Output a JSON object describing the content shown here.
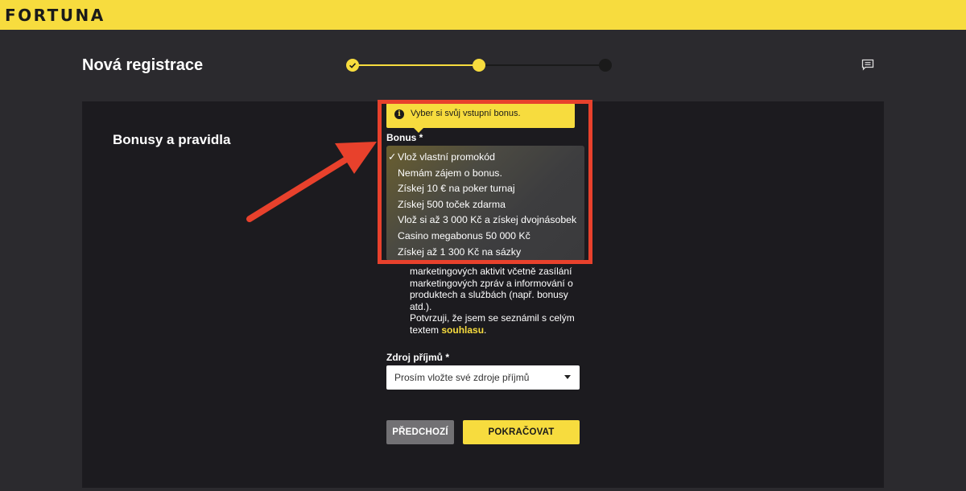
{
  "header": {
    "logo": "FORTUNA"
  },
  "page": {
    "title": "Nová registrace"
  },
  "stepper": {
    "steps_total": 3,
    "current_step": 2,
    "active_color": "#f7dc3e",
    "inactive_color": "#1a1a1a"
  },
  "section": {
    "title": "Bonusy a pravidla"
  },
  "bonus": {
    "tooltip": "Vyber si svůj vstupní bonus.",
    "label": "Bonus *",
    "selected_mark": "✓",
    "options": [
      "Vlož vlastní promokód",
      "Nemám zájem o bonus.",
      "Získej 10 € na poker turnaj",
      "Získej 500 toček zdarma",
      "Vlož si až 3 000 Kč a získej dvojnásobek",
      "Casino megabonus 50 000 Kč",
      "Získej až 1 300 Kč na sázky"
    ],
    "selected_index": 0
  },
  "consent": {
    "lines": [
      "marketingových aktivit včetně zasílání",
      "marketingových zpráv a informování o",
      "produktech a službách (např. bonusy",
      "atd.).",
      "Potvrzuji, že jsem se seznámil s celým"
    ],
    "last_prefix": "textem ",
    "link": "souhlasu",
    "last_suffix": "."
  },
  "income": {
    "label": "Zdroj příjmů *",
    "placeholder": "Prosím vložte své zdroje příjmů"
  },
  "buttons": {
    "prev": "PŘEDCHOZÍ",
    "next": "POKRAČOVAT"
  },
  "colors": {
    "brand_yellow": "#f7dc3e",
    "annotation_red": "#e8412c"
  }
}
